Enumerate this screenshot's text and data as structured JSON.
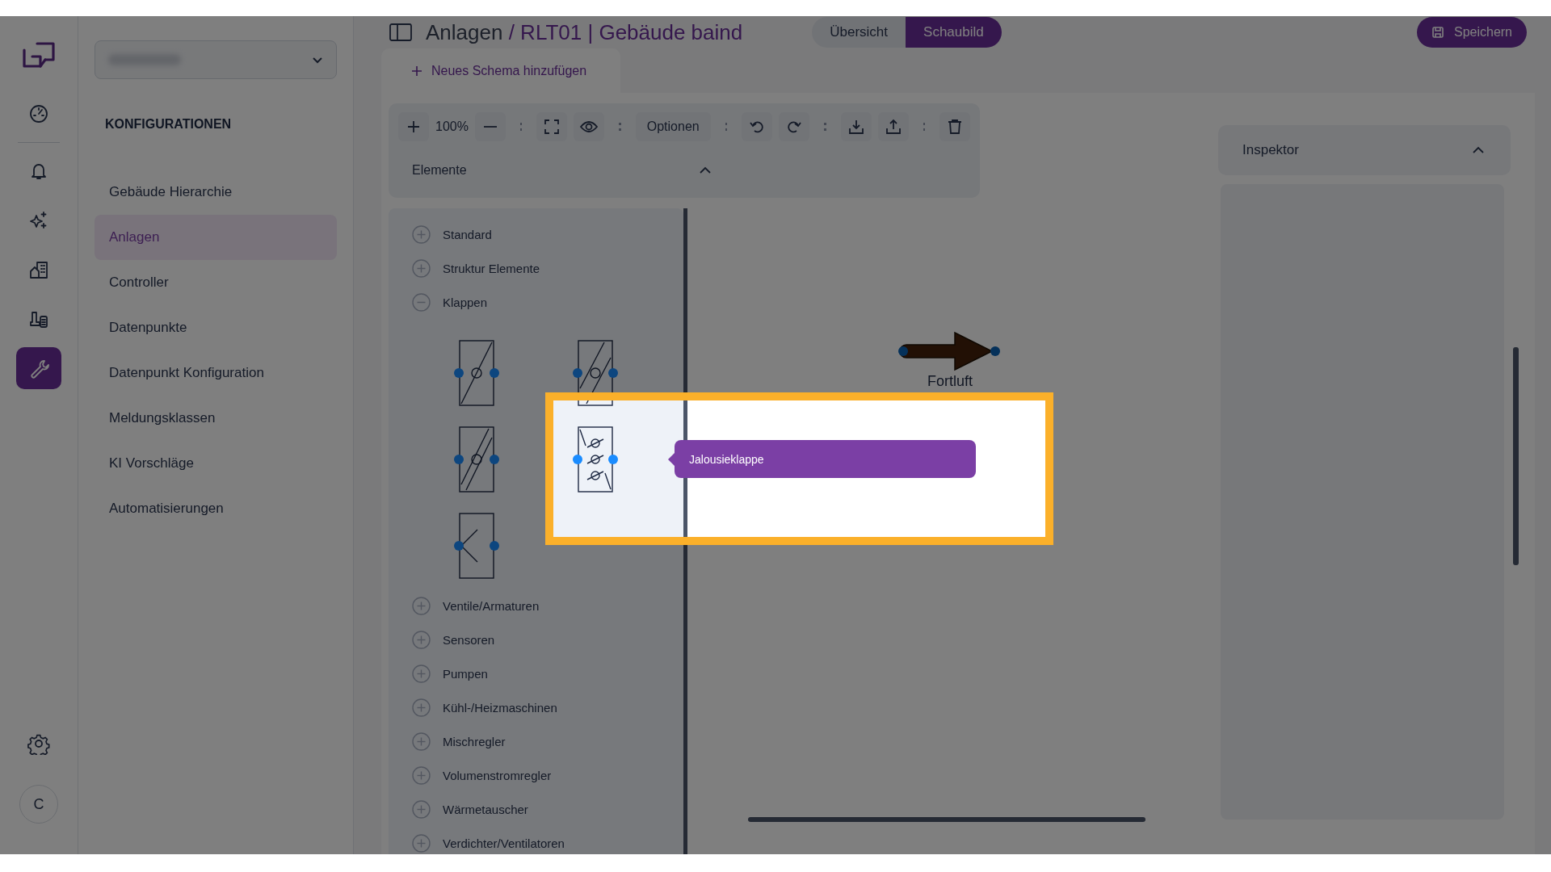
{
  "rail": {
    "items": [
      {
        "selected": false
      },
      {
        "selected": false
      },
      {
        "selected": false
      },
      {
        "selected": false
      },
      {
        "selected": false
      },
      {
        "selected": true
      }
    ],
    "avatar": "C"
  },
  "nav": {
    "heading": "KONFIGURATIONEN",
    "items": [
      {
        "label": "Gebäude Hierarchie",
        "selected": false
      },
      {
        "label": "Anlagen",
        "selected": true
      },
      {
        "label": "Controller",
        "selected": false
      },
      {
        "label": "Datenpunkte",
        "selected": false
      },
      {
        "label": "Datenpunkt Konfiguration",
        "selected": false
      },
      {
        "label": "Meldungsklassen",
        "selected": false
      },
      {
        "label": "KI Vorschläge",
        "selected": false
      },
      {
        "label": "Automatisierungen",
        "selected": false
      }
    ]
  },
  "header": {
    "title": "Anlagen",
    "subtitle": "/ RLT01 | Gebäude baind",
    "views": [
      {
        "label": "Übersicht",
        "selected": false
      },
      {
        "label": "Schaubild",
        "selected": true
      }
    ],
    "save": "Speichern"
  },
  "schema_tab": {
    "label": "Neues Schema hinzufügen"
  },
  "toolbar": {
    "zoom": "100%",
    "options": "Optionen"
  },
  "elements": {
    "title": "Elemente",
    "expanded": true,
    "categories": [
      {
        "label": "Standard",
        "expanded": false
      },
      {
        "label": "Struktur Elemente",
        "expanded": false
      },
      {
        "label": "Klappen",
        "expanded": true
      },
      {
        "label": "Ventile/Armaturen",
        "expanded": false
      },
      {
        "label": "Sensoren",
        "expanded": false
      },
      {
        "label": "Pumpen",
        "expanded": false
      },
      {
        "label": "Kühl-/Heizmaschinen",
        "expanded": false
      },
      {
        "label": "Mischregler",
        "expanded": false
      },
      {
        "label": "Volumenstromregler",
        "expanded": false
      },
      {
        "label": "Wärmetauscher",
        "expanded": false
      },
      {
        "label": "Verdichter/Ventilatoren",
        "expanded": false
      }
    ]
  },
  "canvas": {
    "nodes": [
      {
        "label": "Fortluft"
      }
    ]
  },
  "tooltip": {
    "text": "Jalousieklappe"
  },
  "inspector": {
    "title": "Inspektor",
    "expanded": true
  }
}
